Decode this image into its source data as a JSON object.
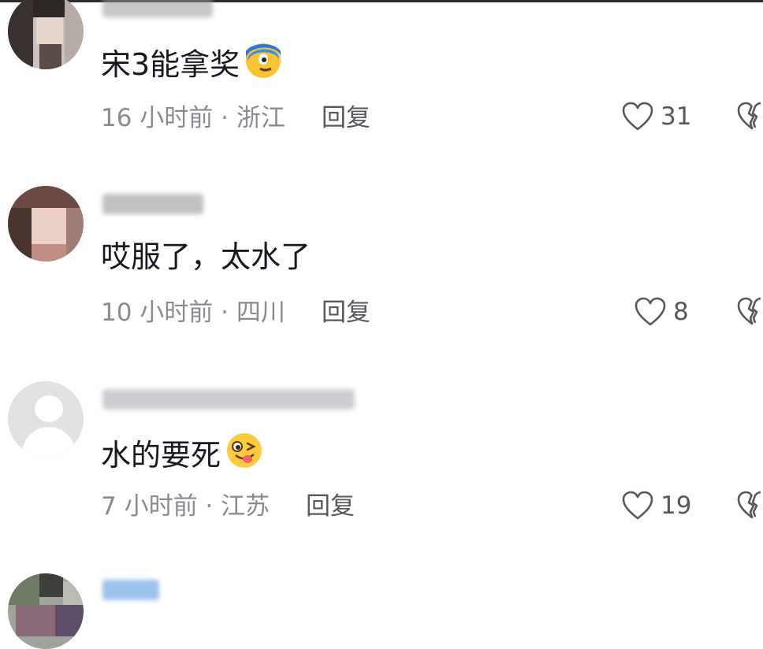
{
  "colors": {
    "text": "#161823",
    "meta": "#8a8b91",
    "icon": "#57585f",
    "background": "#ffffff"
  },
  "comments": [
    {
      "text": "宋3能拿奖",
      "emoji": "confused-face-emoji",
      "meta": "16 小时前 · 浙江",
      "reply_label": "回复",
      "likes": "31"
    },
    {
      "text": "哎服了，太水了",
      "emoji": "",
      "meta": "10 小时前 · 四川",
      "reply_label": "回复",
      "likes": "8"
    },
    {
      "text": "水的要死",
      "emoji": "winking-tongue-emoji",
      "meta": "7 小时前 · 江苏",
      "reply_label": "回复",
      "likes": "19"
    }
  ]
}
